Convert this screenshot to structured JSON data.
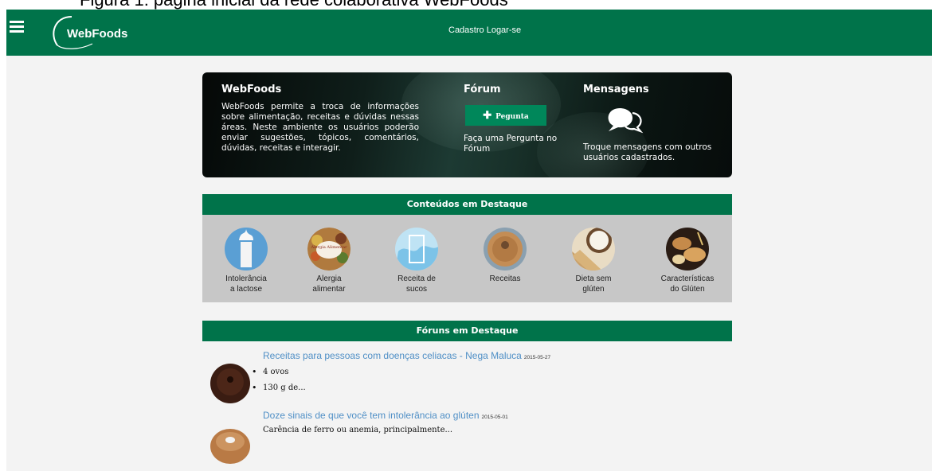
{
  "caption": "Figura 1: página inicial da rede colaborativa WebFoods",
  "header": {
    "logo_text": "WebFoods",
    "nav": {
      "cadastro": "Cadastro",
      "logar": "Logar-se"
    }
  },
  "hero": {
    "col1": {
      "title": "WebFoods",
      "text": "WebFoods permite a troca de informações sobre alimentação, receitas e dúvidas nessas áreas. Neste ambiente os usuários poderão enviar sugestões, tópicos, comentários, dúvidas, receitas e interagir."
    },
    "col2": {
      "title": "Fórum",
      "button_label": "Pegunta",
      "text": "Faça uma Pergunta no Fórum"
    },
    "col3": {
      "title": "Mensagens",
      "text": "Troque mensagens com outros usuários cadastrados."
    }
  },
  "featured": {
    "title": "Conteúdos em Destaque",
    "items": [
      {
        "line1": "Intolerância",
        "line2": "a lactose"
      },
      {
        "line1": "Alergia",
        "line2": "alimentar",
        "image_text": "Alergia Alimentar"
      },
      {
        "line1": "Receita de",
        "line2": "sucos"
      },
      {
        "line1": "Receitas",
        "line2": ""
      },
      {
        "line1": "Dieta sem",
        "line2": "glúten"
      },
      {
        "line1": "Características",
        "line2": "do Glúten"
      }
    ]
  },
  "forums": {
    "title": "Fóruns em Destaque",
    "items": [
      {
        "title": "Receitas para pessoas com doenças celiacas - Nega Maluca",
        "date": "2015-05-27",
        "bullets": [
          "4 ovos",
          "130 g de..."
        ]
      },
      {
        "title": "Doze sinais de que você tem intolerância ao glúten",
        "date": "2015-05-01",
        "text": "Carência de ferro ou anemia, principalmente..."
      }
    ]
  },
  "colors": {
    "primary": "#00734a",
    "button": "#00875a",
    "link": "#4f8fc6",
    "featured_bg": "#c7c7c7"
  }
}
